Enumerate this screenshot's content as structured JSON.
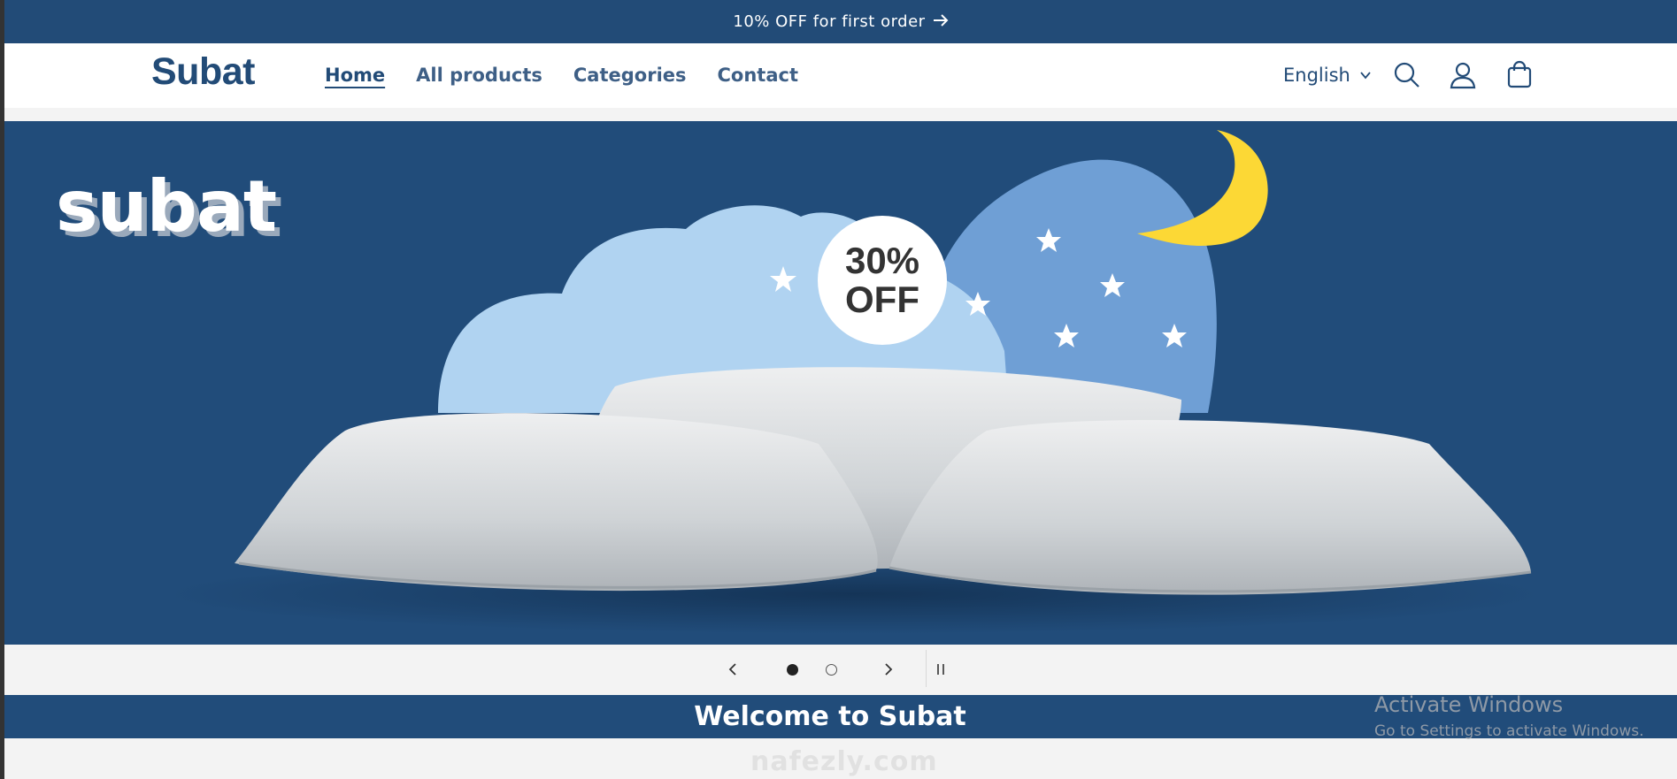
{
  "announcement": {
    "text": "10% OFF for first order",
    "icon": "arrow-right-icon"
  },
  "header": {
    "logo": "Subat",
    "nav": [
      {
        "label": "Home",
        "active": true
      },
      {
        "label": "All products",
        "active": false
      },
      {
        "label": "Categories",
        "active": false
      },
      {
        "label": "Contact",
        "active": false
      }
    ],
    "language": "English",
    "icons": [
      "search-icon",
      "account-icon",
      "cart-icon"
    ]
  },
  "hero": {
    "brand_text": "subat",
    "badge_line1": "30%",
    "badge_line2": "OFF",
    "image": "three white pillows on blue clouds with stars and moon"
  },
  "slider": {
    "slides_total": 2,
    "current_slide": 1,
    "controls": [
      "previous-slide",
      "next-slide",
      "pause"
    ]
  },
  "welcome": {
    "title": "Welcome to Subat"
  },
  "os_overlay": {
    "title": "Activate Windows",
    "subtitle": "Go to Settings to activate Windows."
  },
  "watermark": "nafezly.com",
  "colors": {
    "primary": "#224b77",
    "hero_bg": "#214c7a",
    "moon": "#fcd835",
    "cloud_light": "#b0d3f1",
    "cloud_dark": "#6f9fd5"
  }
}
